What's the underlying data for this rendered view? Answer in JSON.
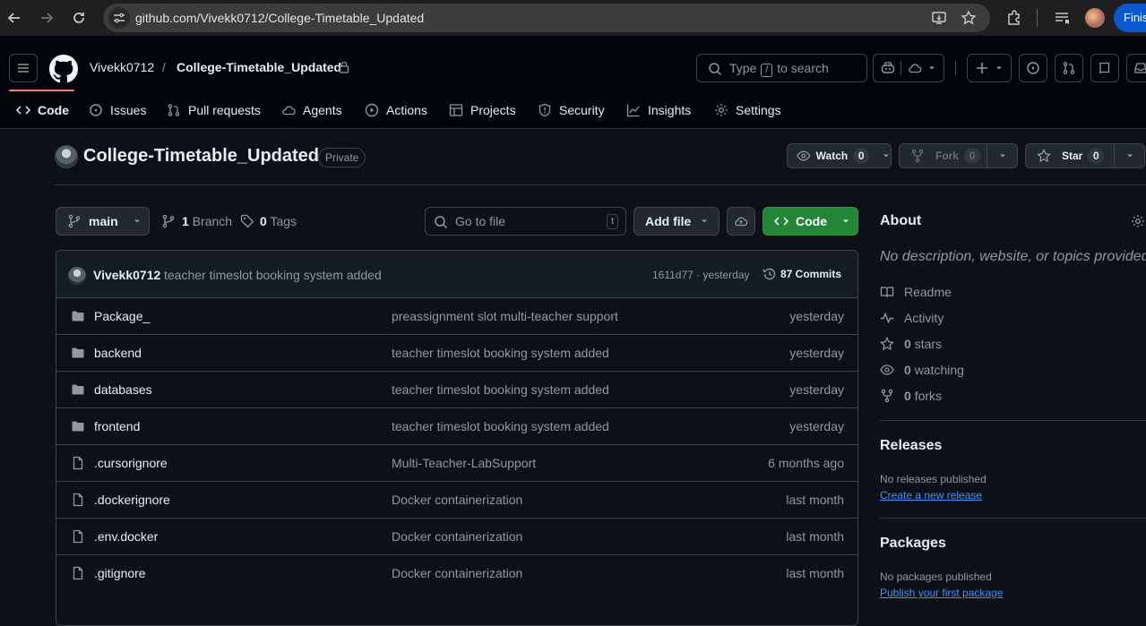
{
  "browser": {
    "url": "github.com/Vivekk0712/College-Timetable_Updated",
    "profile_button": "Finis"
  },
  "header": {
    "owner": "Vivekk0712",
    "separator": "/",
    "repo": "College-Timetable_Updated",
    "search_type": "Type",
    "search_key": "/",
    "search_rest": "to search"
  },
  "tabs": [
    {
      "label": "Code",
      "icon": "code-icon",
      "active": true
    },
    {
      "label": "Issues",
      "icon": "issue-icon"
    },
    {
      "label": "Pull requests",
      "icon": "pull-request-icon"
    },
    {
      "label": "Agents",
      "icon": "agent-icon"
    },
    {
      "label": "Actions",
      "icon": "play-icon"
    },
    {
      "label": "Projects",
      "icon": "table-icon"
    },
    {
      "label": "Security",
      "icon": "shield-icon"
    },
    {
      "label": "Insights",
      "icon": "graph-icon"
    },
    {
      "label": "Settings",
      "icon": "gear-icon"
    }
  ],
  "repo": {
    "title": "College-Timetable_Updated",
    "visibility": "Private",
    "watch_label": "Watch",
    "watch_count": "0",
    "fork_label": "Fork",
    "fork_count": "0",
    "star_label": "Star",
    "star_count": "0"
  },
  "toolbar": {
    "branch": "main",
    "branch_count": "1",
    "branch_word": "Branch",
    "tag_count": "0",
    "tag_word": "Tags",
    "goto_placeholder": "Go to file",
    "goto_key": "t",
    "add_file": "Add file",
    "code_button": "Code"
  },
  "commit": {
    "user": "Vivekk0712",
    "message": "teacher timeslot booking system added",
    "sha_time": "1611d77 · yesterday",
    "commits": "87 Commits"
  },
  "files": [
    {
      "name": "Package_",
      "type": "dir",
      "message": "preassignment slot multi-teacher support",
      "date": "yesterday"
    },
    {
      "name": "backend",
      "type": "dir",
      "message": "teacher timeslot booking system added",
      "date": "yesterday"
    },
    {
      "name": "databases",
      "type": "dir",
      "message": "teacher timeslot booking system added",
      "date": "yesterday"
    },
    {
      "name": "frontend",
      "type": "dir",
      "message": "teacher timeslot booking system added",
      "date": "yesterday"
    },
    {
      "name": ".cursorignore",
      "type": "file",
      "message": "Multi-Teacher-LabSupport",
      "date": "6 months ago"
    },
    {
      "name": ".dockerignore",
      "type": "file",
      "message": "Docker containerization",
      "date": "last month"
    },
    {
      "name": ".env.docker",
      "type": "file",
      "message": "Docker containerization",
      "date": "last month"
    },
    {
      "name": ".gitignore",
      "type": "file",
      "message": "Docker containerization",
      "date": "last month"
    }
  ],
  "about": {
    "title": "About",
    "description": "No description, website, or topics provided.",
    "readme": "Readme",
    "activity": "Activity",
    "stars_count": "0",
    "stars_word": "stars",
    "watching_count": "0",
    "watching_word": "watching",
    "forks_count": "0",
    "forks_word": "forks"
  },
  "releases": {
    "title": "Releases",
    "note": "No releases published",
    "link": "Create a new release"
  },
  "packages": {
    "title": "Packages",
    "note": "No packages published",
    "link": "Publish your first package"
  },
  "colors": {
    "accent_underline": "#f78166",
    "code_button": "#238636",
    "link": "#4493f8"
  }
}
